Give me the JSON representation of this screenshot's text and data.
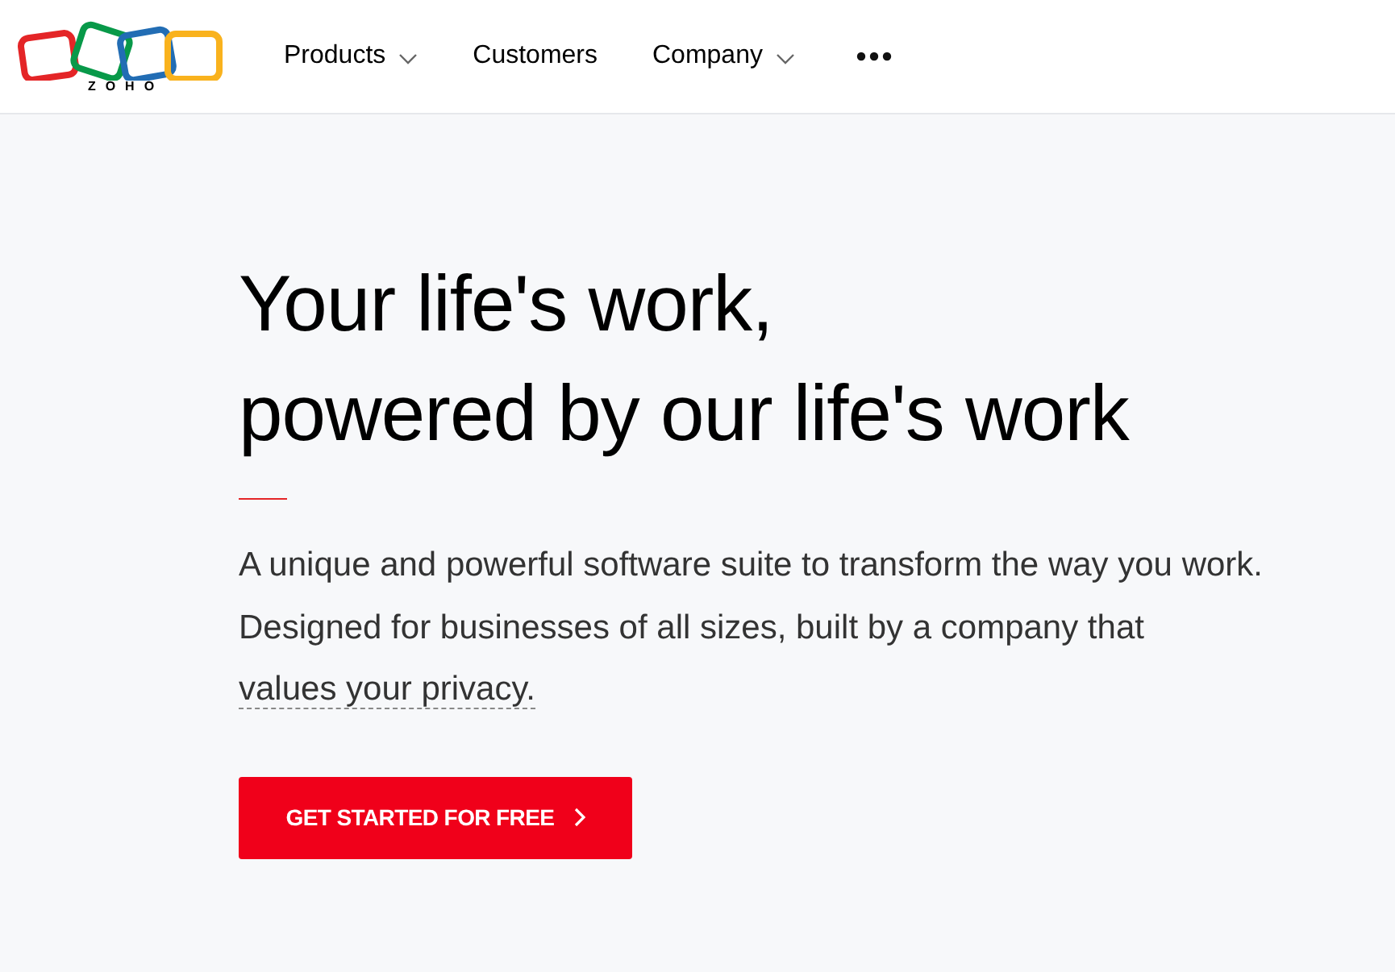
{
  "logo": {
    "text": "ZOHO"
  },
  "nav": [
    {
      "label": "Products",
      "kind": "dropdown"
    },
    {
      "label": "Customers",
      "kind": "link"
    },
    {
      "label": "Company",
      "kind": "dropdown"
    },
    {
      "kind": "more"
    }
  ],
  "hero": {
    "title_lines": [
      "Your life's work,",
      "powered by our life's work"
    ],
    "description": "A unique and powerful software suite to transform the way you work. Designed for businesses of all sizes, built by a company that",
    "description_link": "values your privacy.",
    "cta": "GET STARTED FOR FREE"
  }
}
